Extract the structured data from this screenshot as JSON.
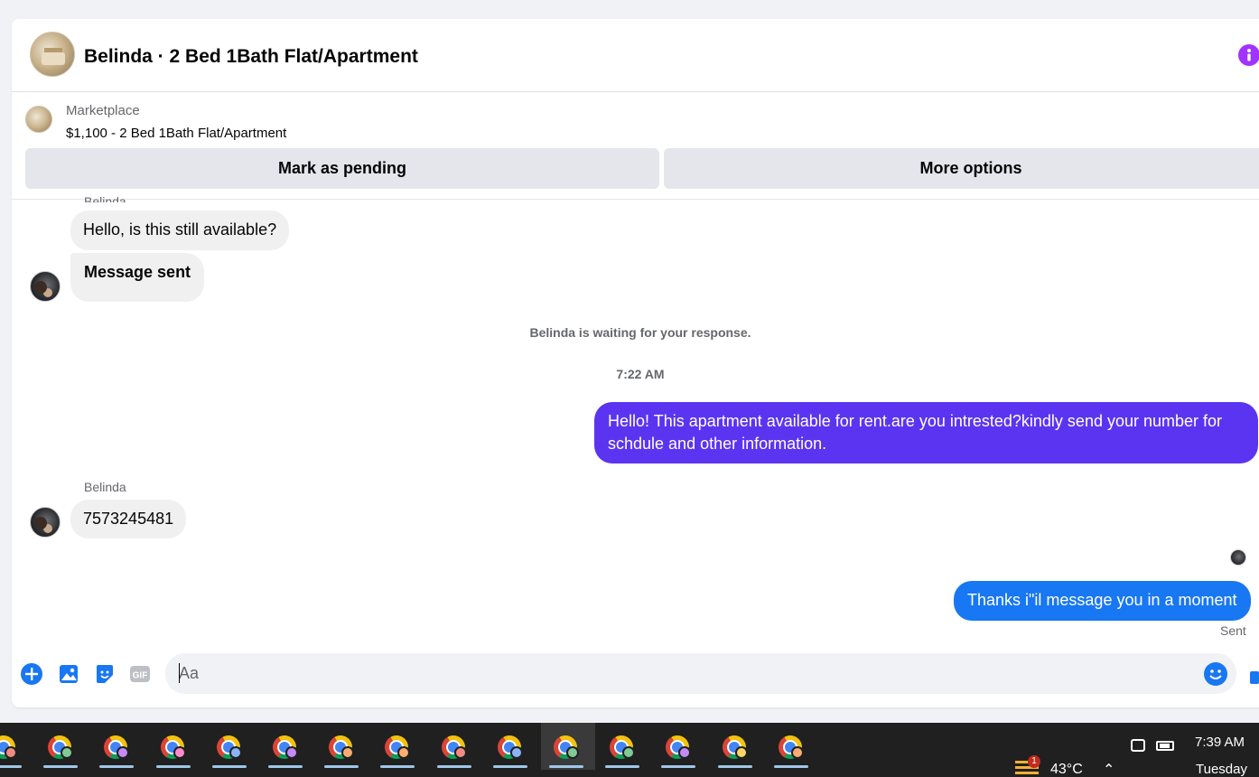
{
  "header": {
    "title": "Belinda · 2 Bed 1Bath Flat/Apartment",
    "info_icon": "info-icon",
    "accent_color": "#a033ff"
  },
  "listing": {
    "source": "Marketplace",
    "price_title": "$1,100 - 2 Bed 1Bath Flat/Apartment",
    "pending_label": "Mark as pending",
    "more_label": "More options"
  },
  "messages": {
    "top_sender_fragment": "Belinda",
    "m1": "Hello, is this still available?",
    "m2": "Message sent",
    "waiting_note": "Belinda is waiting for your response.",
    "timestamp": "7:22 AM",
    "out1": "Hello! This apartment available for rent.are you intrested?kindly send your number for schdule and other information.",
    "sender_name": "Belinda",
    "m3": "7573245481",
    "out2": "Thanks i\"il message you in a moment",
    "sent_status": "Sent",
    "outgoing_color_1": "#5b34f2",
    "outgoing_color_2": "#1877f2"
  },
  "composer": {
    "placeholder": "Aa",
    "icons": [
      "plus-icon",
      "photo-icon",
      "sticker-icon",
      "gif-icon",
      "emoji-icon",
      "like-icon"
    ],
    "gif_label": "GIF"
  },
  "taskbar": {
    "apps": [
      {
        "icon": "chrome-icon",
        "profile_color": "#f28b82"
      },
      {
        "icon": "chrome-icon",
        "profile_color": "#81c995"
      },
      {
        "icon": "chrome-icon",
        "profile_color": "#c58af9"
      },
      {
        "icon": "chrome-icon",
        "profile_color": "#ff8bcb"
      },
      {
        "icon": "chrome-icon",
        "profile_color": "#8ab4f8"
      },
      {
        "icon": "chrome-icon",
        "profile_color": "#c58af9"
      },
      {
        "icon": "chrome-icon",
        "profile_color": "#fcad70"
      },
      {
        "icon": "chrome-icon",
        "profile_color": "#fcad70"
      },
      {
        "icon": "chrome-icon",
        "profile_color": "#f28b82"
      },
      {
        "icon": "chrome-icon",
        "profile_color": "#8ab4f8"
      },
      {
        "icon": "chrome-icon",
        "profile_color": "#81c995"
      },
      {
        "icon": "chrome-icon",
        "profile_color": "#81c995"
      },
      {
        "icon": "chrome-icon",
        "profile_color": "#c58af9"
      },
      {
        "icon": "chrome-icon",
        "profile_color": "#fdd663"
      },
      {
        "icon": "chrome-icon",
        "profile_color": "#fcad70"
      }
    ],
    "weather_badge": "1",
    "temperature": "43°C",
    "time": "7:39 AM",
    "day": "Tuesday"
  }
}
